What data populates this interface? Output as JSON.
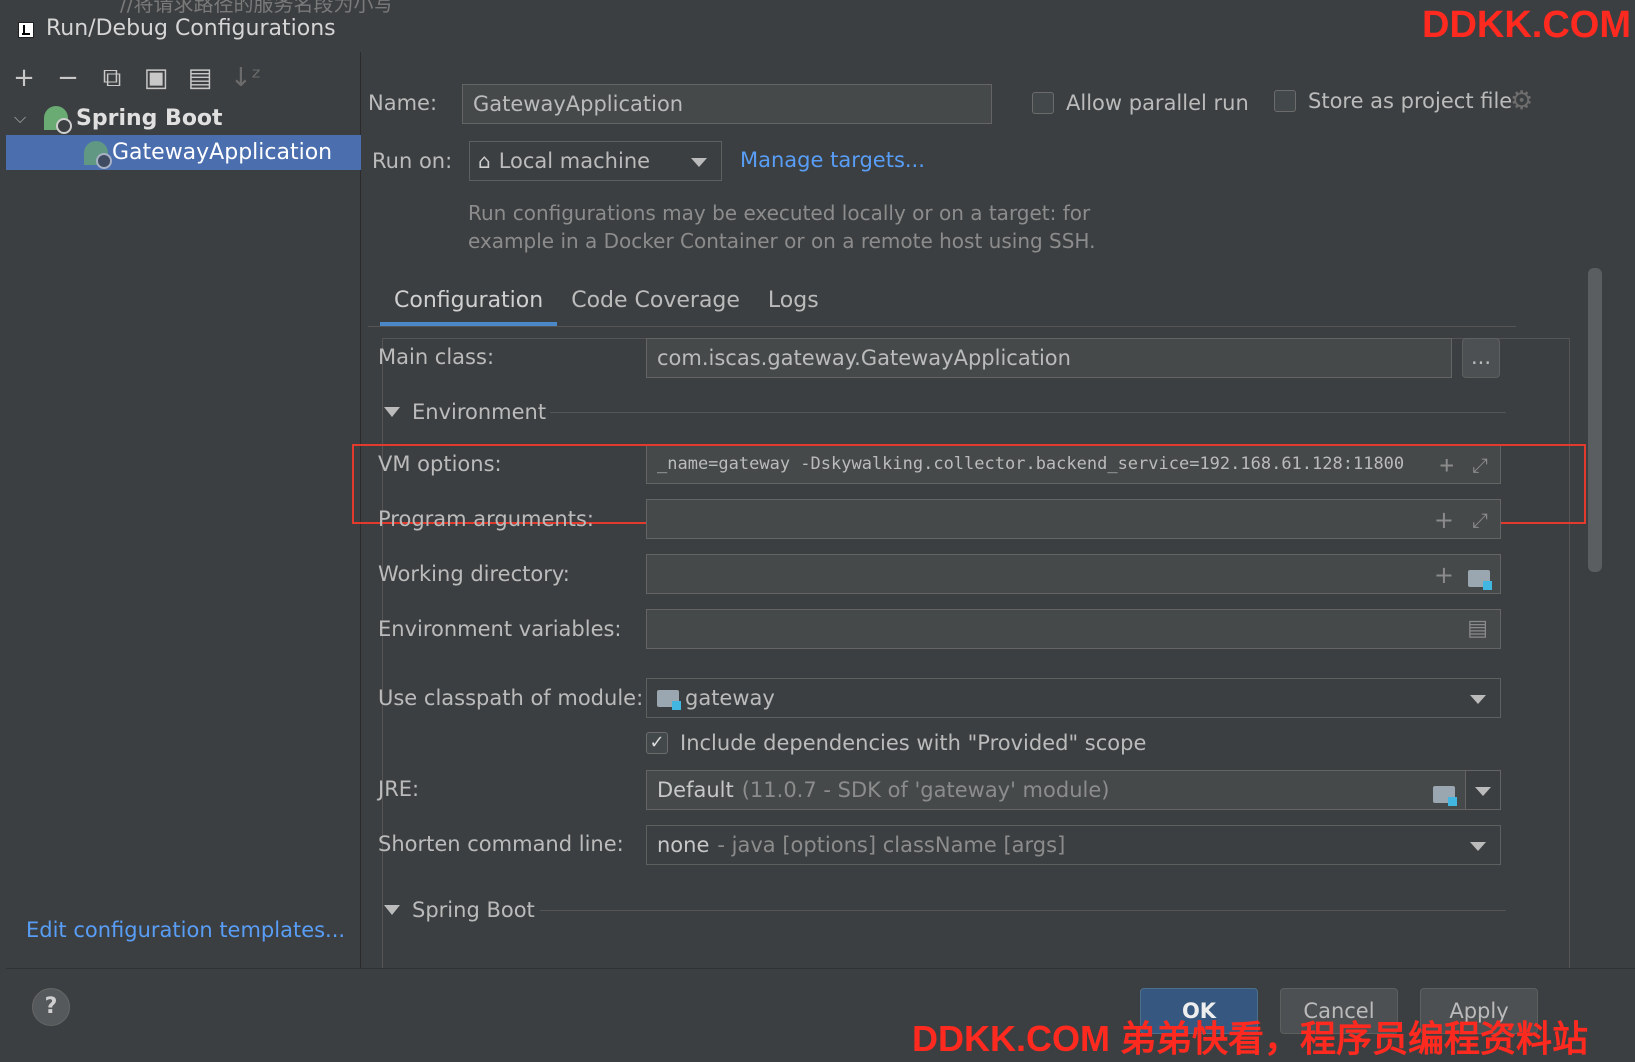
{
  "window": {
    "title": "Run/Debug Configurations",
    "background_text": "//将请求路径的服务名段为小写"
  },
  "watermark": {
    "top": "DDKK.COM",
    "bottom": "DDKK.COM 弟弟快看，程序员编程资料站"
  },
  "toolbar": {
    "add": "+",
    "remove": "−",
    "copy": "⧉",
    "save": "▣",
    "folder": "▤",
    "sort": "↓ᶻ"
  },
  "tree": {
    "group_label": "Spring Boot",
    "item_label": "GatewayApplication"
  },
  "left_footer": {
    "edit_templates": "Edit configuration templates..."
  },
  "header": {
    "name_label": "Name:",
    "name_value": "GatewayApplication",
    "allow_parallel_label": "Allow parallel run",
    "store_project_label": "Store as project file",
    "run_on_label": "Run on:",
    "run_on_value": "Local machine",
    "manage_targets": "Manage targets...",
    "hint_line1": "Run configurations may be executed locally or on a target: for",
    "hint_line2": "example in a Docker Container or on a remote host using SSH."
  },
  "tabs": [
    {
      "label": "Configuration",
      "selected": true
    },
    {
      "label": "Code Coverage",
      "selected": false
    },
    {
      "label": "Logs",
      "selected": false
    }
  ],
  "config": {
    "main_class_label": "Main class:",
    "main_class_value": "com.iscas.gateway.GatewayApplication",
    "browse_label": "...",
    "environment_section": "Environment",
    "vm_options_label": "VM options:",
    "vm_options_value": "_name=gateway -Dskywalking.collector.backend_service=192.168.61.128:11800",
    "program_args_label": "Program arguments:",
    "program_args_value": "",
    "working_dir_label": "Working directory:",
    "working_dir_value": "",
    "env_vars_label": "Environment variables:",
    "env_vars_value": "",
    "classpath_label": "Use classpath of module:",
    "classpath_value": "gateway",
    "include_deps_label": "Include dependencies with \"Provided\" scope",
    "include_deps_checked": true,
    "jre_label": "JRE:",
    "jre_value": "Default",
    "jre_hint": "(11.0.7 - SDK of 'gateway' module)",
    "shorten_label": "Shorten command line:",
    "shorten_value": "none",
    "shorten_hint": "- java [options] className [args]",
    "spring_boot_section": "Spring Boot"
  },
  "buttons": {
    "help": "?",
    "ok": "OK",
    "cancel": "Cancel",
    "apply": "Apply"
  },
  "colors": {
    "background": "#3c3f41",
    "selection": "#4b6eaf",
    "link": "#589df6",
    "highlight_box": "#e23b2d",
    "watermark": "#ff2a1f"
  }
}
